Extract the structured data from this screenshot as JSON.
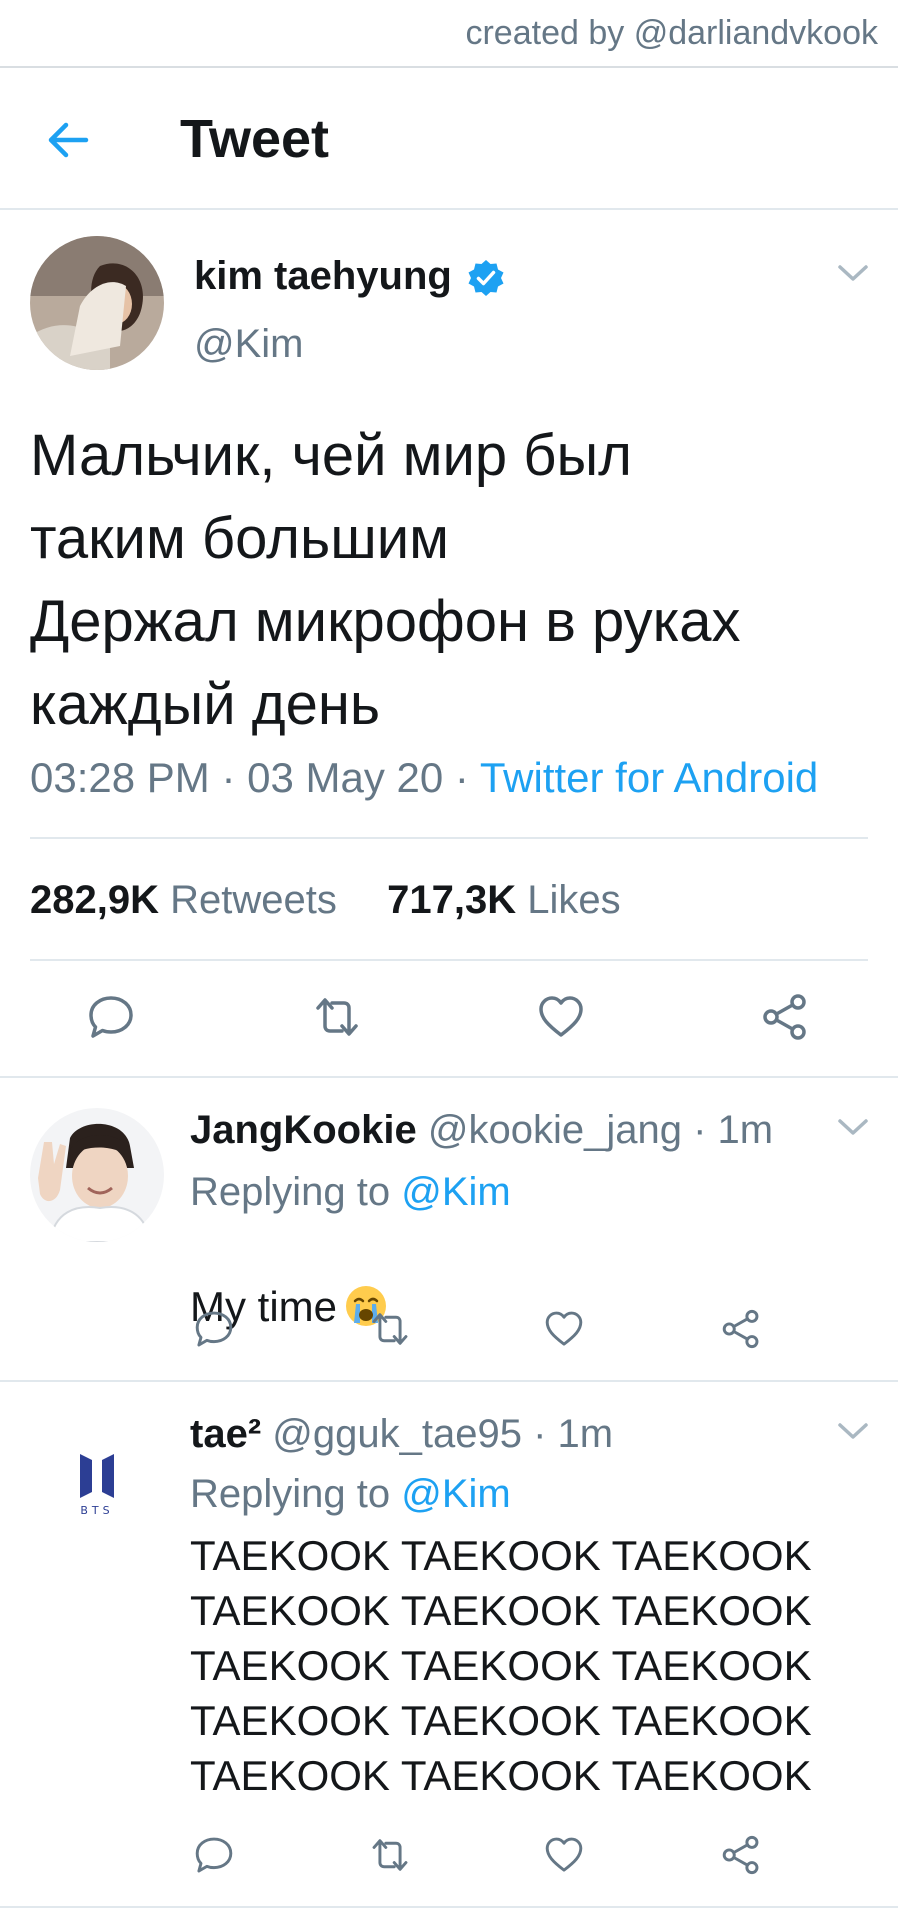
{
  "credit": "created by @darliandvkook",
  "header": {
    "title": "Tweet"
  },
  "tweet": {
    "name": "kim taehyung",
    "handle": "@Kim",
    "text": "Мальчик, чей мир был\nтаким большим\nДержал микрофон в руках\nкаждый день",
    "time": "03:28 PM",
    "date": "03 May 20",
    "source": "Twitter for Android",
    "retweets_count": "282,9K",
    "retweets_label": "Retweets",
    "likes_count": "717,3K",
    "likes_label": "Likes"
  },
  "replies": [
    {
      "name": "JangKookie",
      "handle": "@kookie_jang",
      "time": "1m",
      "replying_label": "Replying to",
      "replying_to": "@Kim",
      "text": "My time",
      "emoji": "crying-face-icon"
    },
    {
      "name": "tae²",
      "handle": "@gguk_tae95",
      "time": "1m",
      "replying_label": "Replying to",
      "replying_to": "@Kim",
      "text": "TAEKOOK TAEKOOK TAEKOOK\nTAEKOOK TAEKOOK TAEKOOK\nTAEKOOK TAEKOOK TAEKOOK\nTAEKOOK TAEKOOK TAEKOOK\nTAEKOOK TAEKOOK TAEKOOK",
      "avatar_text": "BTS"
    }
  ],
  "colors": {
    "accent": "#1da1f2",
    "secondary": "#657786",
    "divider": "#e1e8ed"
  },
  "icons": [
    "back-arrow-icon",
    "verified-badge-icon",
    "chevron-down-icon",
    "reply-icon",
    "retweet-icon",
    "like-icon",
    "share-icon"
  ]
}
